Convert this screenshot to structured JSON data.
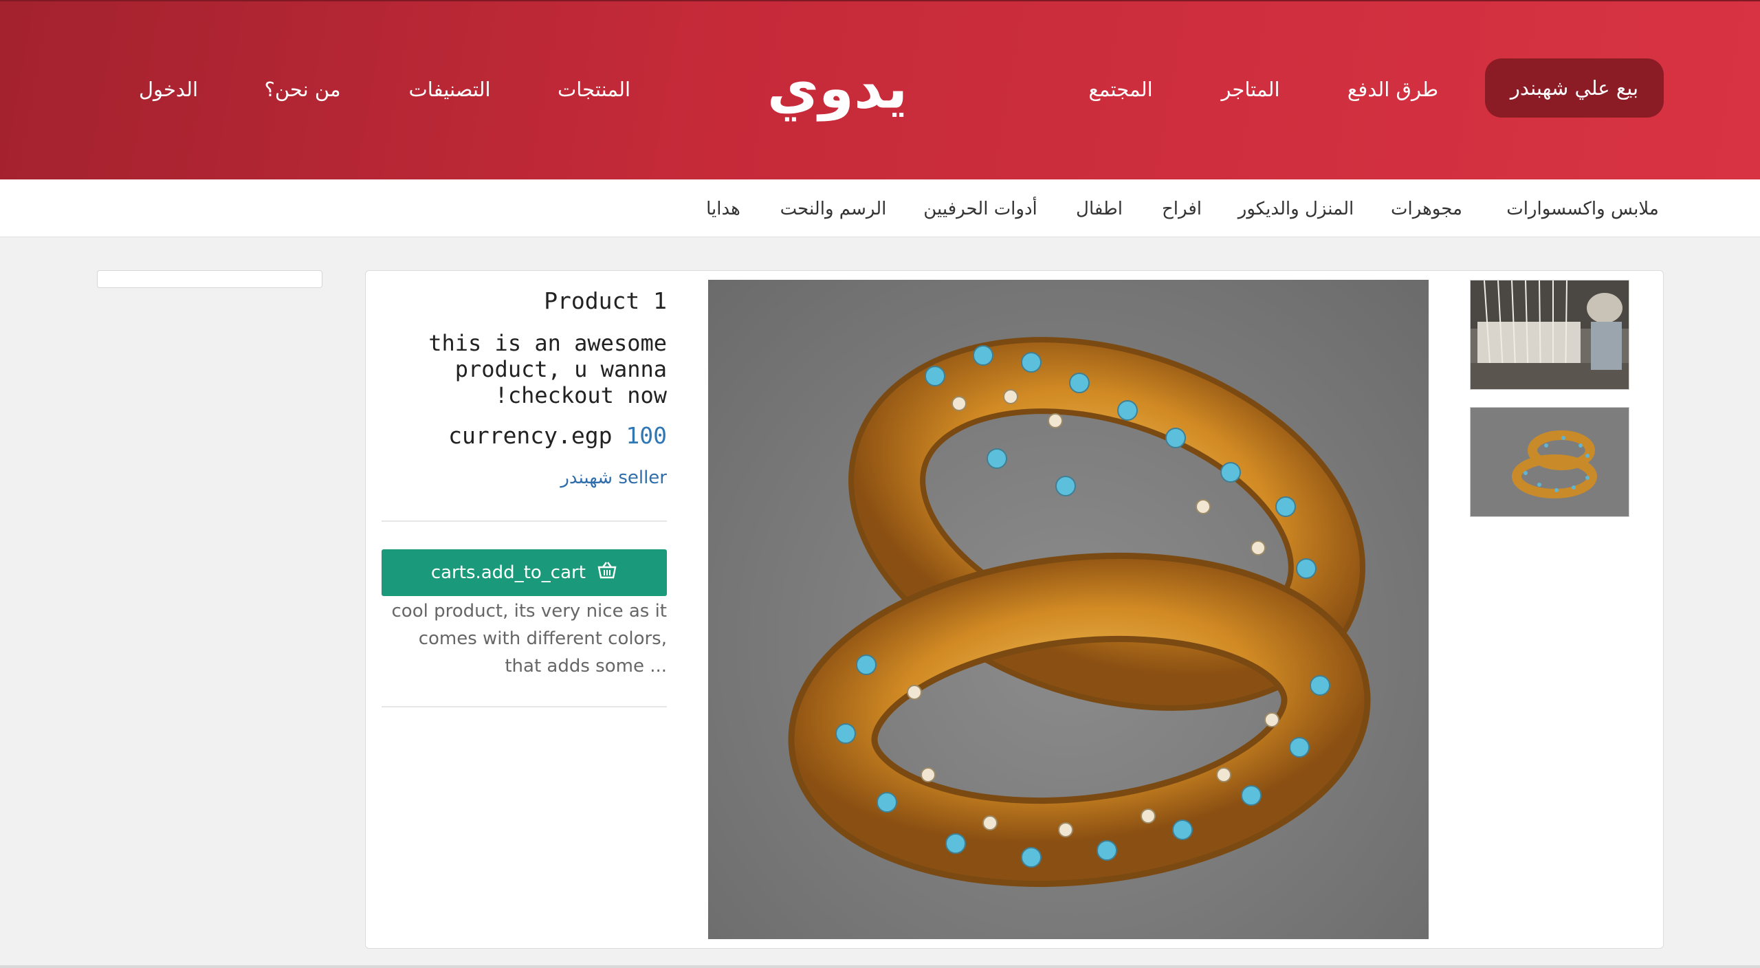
{
  "header": {
    "logo": "يدوي",
    "sell_button": "بيع علي شهبندر",
    "nav_right": [
      "طرق الدفع",
      "المتاجر",
      "المجتمع"
    ],
    "nav_left": [
      "المنتجات",
      "التصنيفات",
      "من نحن؟",
      "الدخول"
    ]
  },
  "categories": [
    "ملابس واكسسوارات",
    "مجوهرات",
    "المنزل والديكور",
    "افراح",
    "اطفال",
    "أدوات الحرفيين",
    "الرسم والنحت",
    "هدايا"
  ],
  "product": {
    "title": "Product 1",
    "description": "this is an awesome product, u wanna checkout now!",
    "currency_label": "currency.egp",
    "price": "100",
    "seller_label": "seller",
    "seller_name": "شهبندر",
    "add_to_cart": "carts.add_to_cart",
    "long_description": "cool product, its very nice as it comes with different colors, that adds some ..."
  },
  "colors": {
    "header": "#c52a39",
    "sell_button": "#8b1c26",
    "cart_button": "#1a9a7a",
    "link": "#2f6eab"
  }
}
